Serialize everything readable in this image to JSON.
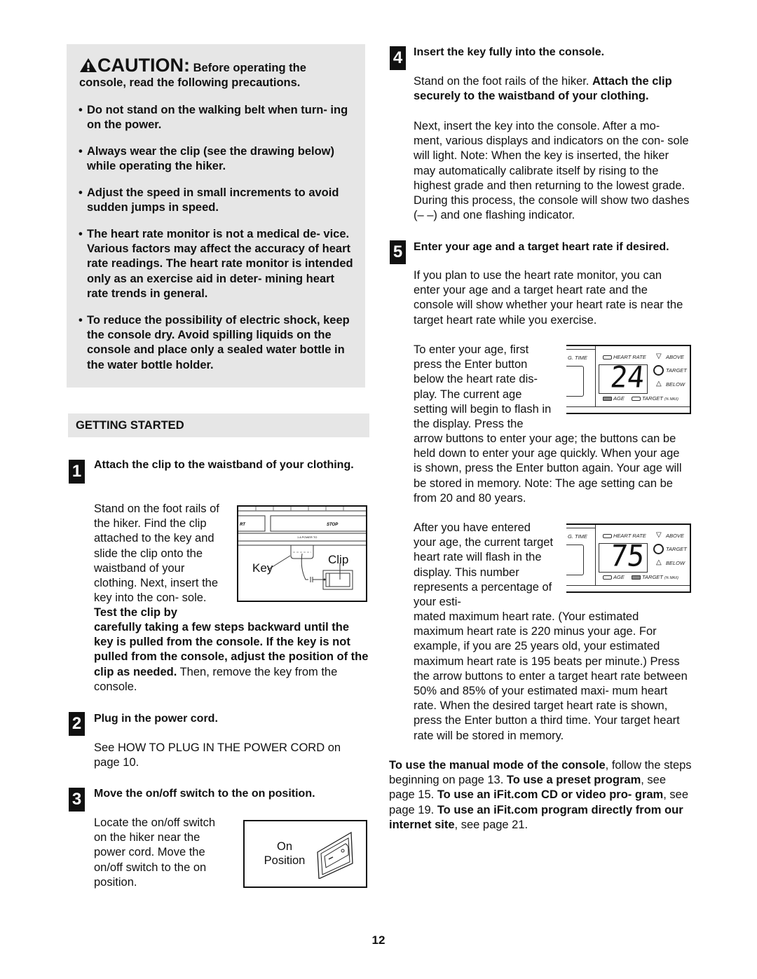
{
  "caution": {
    "icon": "warning-triangle-icon",
    "label": "CAUTION:",
    "intro_inline": " Before operating the",
    "intro_line2": "console, read the following precautions.",
    "bullets": [
      "Do not stand on the walking belt when turn- ing on the power.",
      "Always wear the clip (see the drawing below) while operating the hiker.",
      "Adjust the speed in small increments to avoid sudden jumps in speed.",
      "The heart rate monitor is not a medical de- vice. Various factors may affect the accuracy of heart rate readings. The heart rate monitor is intended only as an exercise aid in deter- mining heart rate trends in general.",
      "To reduce the possibility of electric shock, keep the console dry. Avoid spilling liquids on the console and place only a sealed water bottle in the water bottle holder."
    ]
  },
  "section": {
    "title": "GETTING STARTED"
  },
  "steps": {
    "s1": {
      "number": "1",
      "heading": "Attach the clip to the waistband of your clothing.",
      "body_wrap": "Stand on the foot rails of the hiker. Find the clip attached to the key and slide the clip onto the waistband of your clothing. Next, insert the key into the con- sole.",
      "body_bold_start": "Test the clip by",
      "body_bold_cont": "carefully taking a few steps backward until the key is pulled from the console. If the key is not pulled from the console, adjust the position of the clip as needed.",
      "body_end": " Then, remove the key from the console.",
      "figure": {
        "label_key": "Key",
        "label_clip": "Clip",
        "console_left": "RT",
        "console_stop": "STOP",
        "console_small": "1 A  POWER TO"
      }
    },
    "s2": {
      "number": "2",
      "heading": "Plug in the power cord.",
      "body": "See HOW TO PLUG IN THE POWER CORD on page 10."
    },
    "s3": {
      "number": "3",
      "heading": "Move the on/off switch to the on position.",
      "body": "Locate the on/off switch on the hiker near the power cord. Move the on/off switch to the on position.",
      "figure": {
        "label_line1": "On",
        "label_line2": "Position"
      }
    },
    "s4": {
      "number": "4",
      "heading": "Insert the key fully into the console.",
      "p1_normal": "Stand on the foot rails of the hiker. ",
      "p1_bold": "Attach the clip securely to the waistband of your clothing.",
      "p2": "Next, insert the key into the console. After a mo- ment, various displays and indicators on the con- sole will light. Note: When the key is inserted, the hiker may automatically calibrate itself by rising to the highest grade and then returning to the lowest grade. During this process, the console will show two dashes (– –) and one flashing indicator."
    },
    "s5": {
      "number": "5",
      "heading": "Enter your age and a target heart rate if desired.",
      "p1": "If you plan to use the heart rate monitor, you can enter your age and a target heart rate and the console will show whether your heart rate is near the target heart rate while you exercise.",
      "p2_wrap": "To enter your age, first press the Enter button below the heart rate dis- play. The current age setting will begin to flash in the display. Press the",
      "p2_cont": "arrow buttons to enter your age; the buttons can be held down to enter your age quickly. When your age is shown, press the Enter button again. Your age will be stored in memory. Note: The age setting can be from 20 and 80 years.",
      "p3_wrap": "After you have entered your age, the current target heart rate will flash in the display. This number represents a percentage of your esti-",
      "p3_cont": "mated maximum heart rate. (Your estimated maximum heart rate is 220 minus your age. For example, if you are 25 years old, your estimated maximum heart rate is 195 beats per minute.) Press the arrow buttons to enter a target heart rate between 50% and 85% of your estimated maxi- mum heart rate. When the desired target heart rate is shown, press the Enter button a third time. Your target heart rate will be stored in memory.",
      "display_age": {
        "value": "24",
        "time_label": "G. TIME",
        "heart_rate": "HEART RATE",
        "above": "ABOVE",
        "target": "TARGET",
        "below": "BELOW",
        "age": "AGE",
        "target_max": "TARGET",
        "pct_max": "(% MAX)",
        "active": "age"
      },
      "display_target": {
        "value": "75",
        "time_label": "G. TIME",
        "heart_rate": "HEART RATE",
        "above": "ABOVE",
        "target": "TARGET",
        "below": "BELOW",
        "age": "AGE",
        "target_max": "TARGET",
        "pct_max": "(% MAX)",
        "active": "target"
      }
    }
  },
  "closing": {
    "b1": "To use the manual mode of the console",
    "n1": ", follow the steps beginning on page 13. ",
    "b2": "To use a preset program",
    "n2": ", see page 15. ",
    "b3": "To use an iFit.com CD or video pro- gram",
    "n3": ", see page 19. ",
    "b4": "To use an iFit.com program directly from our internet site",
    "n4": ", see page 21."
  },
  "page_number": "12"
}
